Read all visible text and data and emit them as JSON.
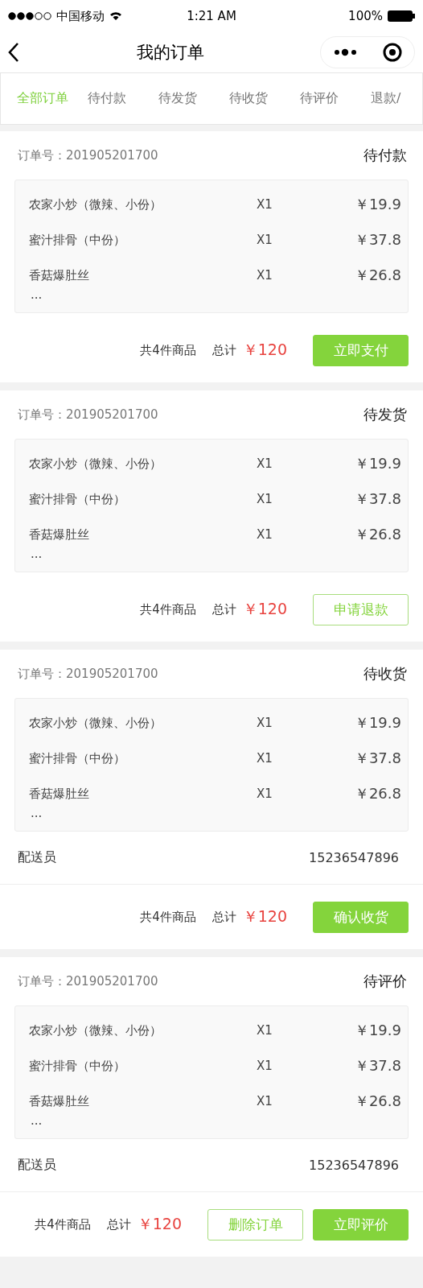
{
  "status_bar": {
    "carrier": "中国移动",
    "time": "1:21 AM",
    "battery": "100%"
  },
  "nav": {
    "title": "我的订单"
  },
  "tabs": [
    {
      "label": "全部订单",
      "selected": true
    },
    {
      "label": "待付款",
      "selected": false
    },
    {
      "label": "待发货",
      "selected": false
    },
    {
      "label": "待收货",
      "selected": false
    },
    {
      "label": "待评价",
      "selected": false
    },
    {
      "label": "退款/",
      "selected": false
    }
  ],
  "orders": [
    {
      "order_no": "订单号：201905201700",
      "status": "待付款",
      "items": [
        {
          "name": "农家小炒（微辣、小份）",
          "qty": "X1",
          "price": "￥19.9"
        },
        {
          "name": "蜜汁排骨（中份）",
          "qty": "X1",
          "price": "￥37.8"
        },
        {
          "name": "香菇爆肚丝",
          "qty": "X1",
          "price": "￥26.8"
        }
      ],
      "more": "···",
      "count": "共4件商品",
      "total_label": "总计",
      "total": "￥120",
      "buttons": [
        {
          "label": "立即支付",
          "kind": "primary"
        }
      ]
    },
    {
      "order_no": "订单号：201905201700",
      "status": "待发货",
      "items": [
        {
          "name": "农家小炒（微辣、小份）",
          "qty": "X1",
          "price": "￥19.9"
        },
        {
          "name": "蜜汁排骨（中份）",
          "qty": "X1",
          "price": "￥37.8"
        },
        {
          "name": "香菇爆肚丝",
          "qty": "X1",
          "price": "￥26.8"
        }
      ],
      "more": "···",
      "count": "共4件商品",
      "total_label": "总计",
      "total": "￥120",
      "buttons": [
        {
          "label": "申请退款",
          "kind": "outline"
        }
      ]
    },
    {
      "order_no": "订单号：201905201700",
      "status": "待收货",
      "items": [
        {
          "name": "农家小炒（微辣、小份）",
          "qty": "X1",
          "price": "￥19.9"
        },
        {
          "name": "蜜汁排骨（中份）",
          "qty": "X1",
          "price": "￥37.8"
        },
        {
          "name": "香菇爆肚丝",
          "qty": "X1",
          "price": "￥26.8"
        }
      ],
      "more": "···",
      "courier": {
        "label": "配送员",
        "phone": "15236547896"
      },
      "count": "共4件商品",
      "total_label": "总计",
      "total": "￥120",
      "buttons": [
        {
          "label": "确认收货",
          "kind": "primary"
        }
      ]
    },
    {
      "order_no": "订单号：201905201700",
      "status": "待评价",
      "items": [
        {
          "name": "农家小炒（微辣、小份）",
          "qty": "X1",
          "price": "￥19.9"
        },
        {
          "name": "蜜汁排骨（中份）",
          "qty": "X1",
          "price": "￥37.8"
        },
        {
          "name": "香菇爆肚丝",
          "qty": "X1",
          "price": "￥26.8"
        }
      ],
      "more": "···",
      "courier": {
        "label": "配送员",
        "phone": "15236547896"
      },
      "count": "共4件商品",
      "total_label": "总计",
      "total": "￥120",
      "buttons": [
        {
          "label": "删除订单",
          "kind": "outline"
        },
        {
          "label": "立即评价",
          "kind": "primary"
        }
      ]
    }
  ]
}
